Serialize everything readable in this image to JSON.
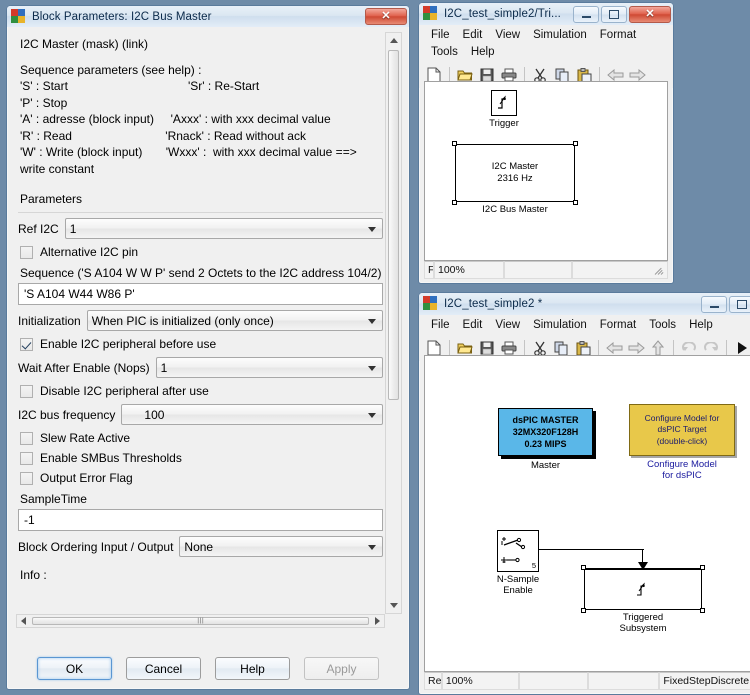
{
  "dialog": {
    "title": "Block Parameters: I2C Bus Master",
    "icon": "simulink-block-icon",
    "close_label": "✕",
    "header": "I2C Master (mask) (link)",
    "description_lines": [
      "Sequence parameters (see help) :",
      "'S' : Start                                    'Sr' : Re-Start",
      "'P' : Stop",
      "'A' : adresse (block input)     'Axxx' : with xxx decimal value",
      "'R' : Read                            'Rnack' : Read without ack",
      "'W' : Write (block input)       'Wxxx' :  with xxx decimal value ==>",
      "write constant"
    ],
    "parameters_label": "Parameters",
    "ref_i2c": {
      "label": "Ref I2C",
      "value": "1"
    },
    "alternative_pin": {
      "label": "Alternative I2C pin",
      "checked": false
    },
    "sequence": {
      "label": "Sequence ('S A104 W W P' send 2 Octets to the I2C address 104/2)",
      "value": "'S A104 W44 W86 P'"
    },
    "initialization": {
      "label": "Initialization",
      "value": "When PIC is initialized (only once)"
    },
    "enable_peripheral": {
      "label": "Enable I2C peripheral  before use",
      "checked": true
    },
    "wait_after_enable": {
      "label": "Wait After Enable (Nops)",
      "value": "1"
    },
    "disable_peripheral": {
      "label": "Disable I2C peripheral after use",
      "checked": false
    },
    "bus_frequency": {
      "label": "I2C bus frequency",
      "value": "100"
    },
    "slew_rate": {
      "label": "Slew Rate Active",
      "checked": false
    },
    "smbus_thresholds": {
      "label": "Enable SMBus Thresholds",
      "checked": false
    },
    "output_error_flag": {
      "label": "Output Error Flag",
      "checked": false
    },
    "sample_time": {
      "label": "SampleTime",
      "value": "-1"
    },
    "block_ordering": {
      "label": "Block Ordering Input / Output",
      "value": "None"
    },
    "info_label": "Info :",
    "buttons": {
      "ok": "OK",
      "cancel": "Cancel",
      "help": "Help",
      "apply": "Apply"
    }
  },
  "sim_trigger_window": {
    "title": "I2C_test_simple2/Tri...",
    "menus": [
      "File",
      "Edit",
      "View",
      "Simulation",
      "Format",
      "Tools",
      "Help"
    ],
    "toolbar_icons": [
      "new-icon",
      "open-icon",
      "save-icon",
      "print-icon",
      "cut-icon",
      "copy-icon",
      "paste-icon",
      "back-icon",
      "forward-icon"
    ],
    "window_buttons": {
      "minimize": "minimize-button",
      "maximize": "maximize-button",
      "close": "close-button"
    },
    "blocks": {
      "trigger": {
        "label": "Trigger"
      },
      "i2c_master": {
        "line1": "I2C Master",
        "line2": "2316 Hz",
        "label": "I2C Bus Master"
      }
    },
    "status": {
      "left": "F",
      "zoom": "100%",
      "cell2": "",
      "cell3": ""
    }
  },
  "sim_model_window": {
    "title": "I2C_test_simple2 *",
    "menus": [
      "File",
      "Edit",
      "View",
      "Simulation",
      "Format",
      "Tools",
      "Help"
    ],
    "toolbar_icons": [
      "new-icon",
      "open-icon",
      "save-icon",
      "print-icon",
      "cut-icon",
      "copy-icon",
      "paste-icon",
      "back-icon",
      "forward-icon",
      "up-icon",
      "undo-icon",
      "redo-icon",
      "start-simulation-icon"
    ],
    "window_buttons": {
      "minimize": "minimize-button",
      "maximize": "maximize-button"
    },
    "blocks": {
      "master": {
        "line1": "dsPIC MASTER",
        "line2": "32MX320F128H",
        "line3": "0.23 MIPS",
        "label": "Master"
      },
      "configure": {
        "line1": "Configure Model for",
        "line2": "dsPIC Target",
        "line3": "(double-click)",
        "label_line1": "Configure Model",
        "label_line2": "for dsPIC"
      },
      "n_sample_enable": {
        "label_line1": "N-Sample",
        "label_line2": "Enable",
        "count": "5"
      },
      "triggered_subsystem": {
        "label_line1": "Triggered",
        "label_line2": "Subsystem"
      }
    },
    "status": {
      "left": "Re",
      "zoom": "100%",
      "cell2": "",
      "cell3": "",
      "solver": "FixedStepDiscrete"
    }
  },
  "colors": {
    "desktop": "#6e8ba8",
    "master_block": "#5ab7e8",
    "configure_block": "#e8c84a",
    "close_button": "#cf4a34",
    "label_blue": "#1a1a9e"
  }
}
